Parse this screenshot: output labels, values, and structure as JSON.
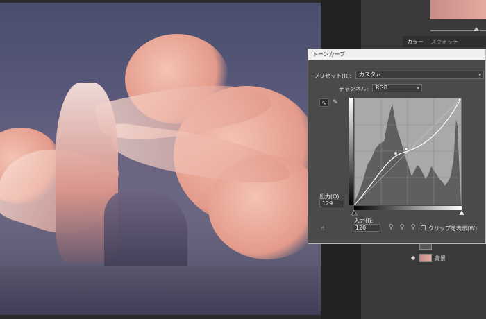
{
  "dialog": {
    "title": "トーンカーブ",
    "preset_label": "プリセット(R):",
    "preset_value": "カスタム",
    "channel_label": "チャンネル:",
    "channel_value": "RGB",
    "output_label": "出力(O):",
    "output_value": "129",
    "input_label": "入力(I):",
    "input_value": "120",
    "clip_label": "クリップを表示(W)"
  },
  "panel": {
    "color_tab": "カラー",
    "swatch_tab": "スウォッチ",
    "layer_name": "背景"
  },
  "icons": {
    "curve_tool": "curve-point-icon",
    "pencil_tool": "pencil-icon",
    "hand_tool": "target-adjust-icon",
    "eyedropper_black": "eyedropper-black-icon",
    "eyedropper_gray": "eyedropper-gray-icon",
    "eyedropper_white": "eyedropper-white-icon",
    "visibility": "eye-icon"
  }
}
